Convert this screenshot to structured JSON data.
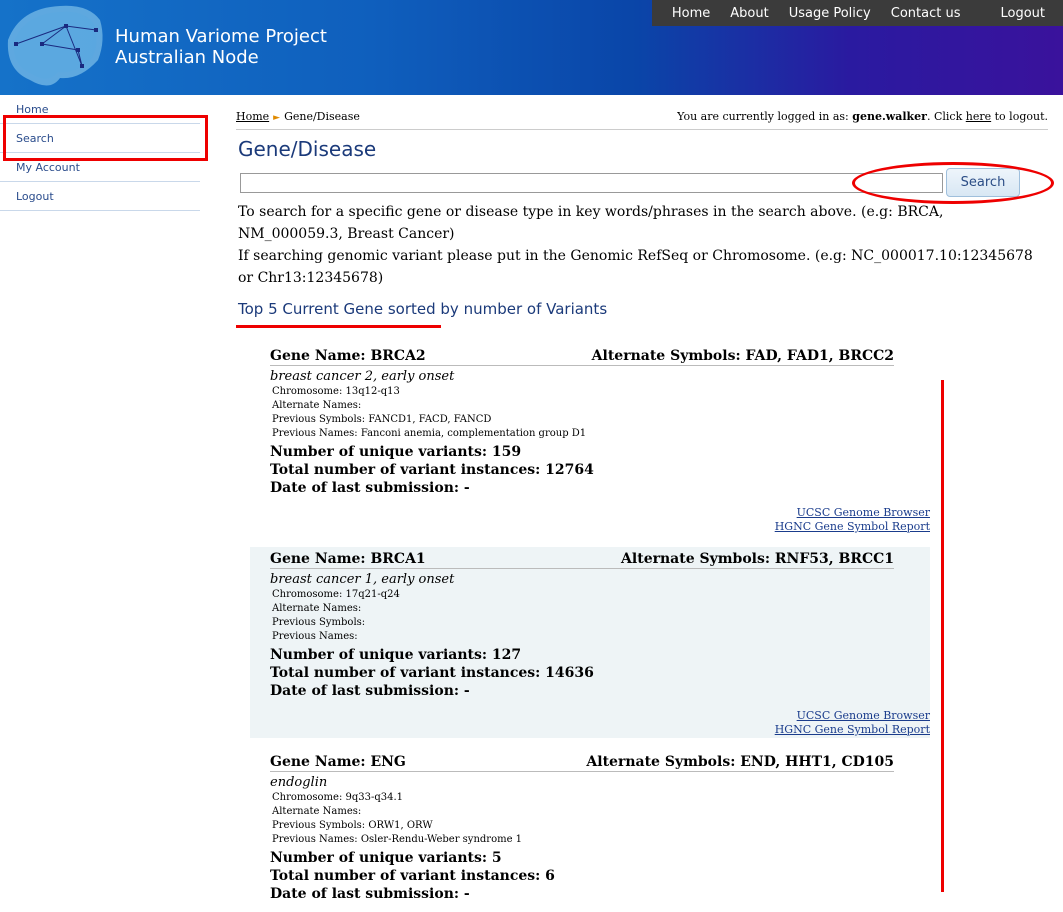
{
  "header": {
    "title_line1": "Human Variome Project",
    "title_line2": "Australian Node",
    "nav": [
      "Home",
      "About",
      "Usage Policy",
      "Contact us",
      "Logout"
    ]
  },
  "sidebar": {
    "items": [
      {
        "label": "Home"
      },
      {
        "label": "Search"
      },
      {
        "label": "My Account"
      },
      {
        "label": "Logout"
      }
    ]
  },
  "breadcrumb": {
    "home": "Home",
    "current": "Gene/Disease"
  },
  "login": {
    "prefix": "You are currently logged in as:",
    "user": "gene.walker",
    "middle": ". Click",
    "link": "here",
    "suffix": "to logout."
  },
  "page": {
    "title": "Gene/Disease",
    "search_value": "",
    "search_button": "Search",
    "help_line1": "To search for a specific gene or disease type in key words/phrases in the search above. (e.g: BRCA, NM_000059.3, Breast Cancer)",
    "help_line2": "If searching genomic variant please put in the Genomic RefSeq or Chromosome. (e.g: NC_000017.10:12345678 or Chr13:12345678)",
    "section_title": "Top 5 Current Gene sorted by number of Variants"
  },
  "genes": [
    {
      "name": "Gene Name: BRCA2",
      "alt": "Alternate Symbols: FAD, FAD1, BRCC2",
      "full": "breast cancer 2, early onset",
      "chromosome": "Chromosome: 13q12-q13",
      "alt_names": "Alternate Names:",
      "prev_symbols": "Previous Symbols: FANCD1, FACD, FANCD",
      "prev_names": "Previous Names: Fanconi anemia, complementation group D1",
      "unique": "Number of unique variants: 159",
      "total": "Total number of variant instances: 12764",
      "date": "Date of last submission: -",
      "link1": "UCSC Genome Browser",
      "link2": "HGNC Gene Symbol Report"
    },
    {
      "name": "Gene Name: BRCA1",
      "alt": "Alternate Symbols: RNF53, BRCC1",
      "full": "breast cancer 1, early onset",
      "chromosome": "Chromosome: 17q21-q24",
      "alt_names": "Alternate Names:",
      "prev_symbols": "Previous Symbols:",
      "prev_names": "Previous Names:",
      "unique": "Number of unique variants: 127",
      "total": "Total number of variant instances: 14636",
      "date": "Date of last submission: -",
      "link1": "UCSC Genome Browser",
      "link2": "HGNC Gene Symbol Report"
    },
    {
      "name": "Gene Name: ENG",
      "alt": "Alternate Symbols: END, HHT1, CD105",
      "full": "endoglin",
      "chromosome": "Chromosome: 9q33-q34.1",
      "alt_names": "Alternate Names:",
      "prev_symbols": "Previous Symbols: ORW1, ORW",
      "prev_names": "Previous Names: Osler-Rendu-Weber syndrome 1",
      "unique": "Number of unique variants: 5",
      "total": "Total number of variant instances: 6",
      "date": "Date of last submission: -"
    }
  ],
  "colors": {
    "accent": "#1b3a7a",
    "annotation": "#ee0000",
    "nav_bar": "#3b3b3b"
  }
}
